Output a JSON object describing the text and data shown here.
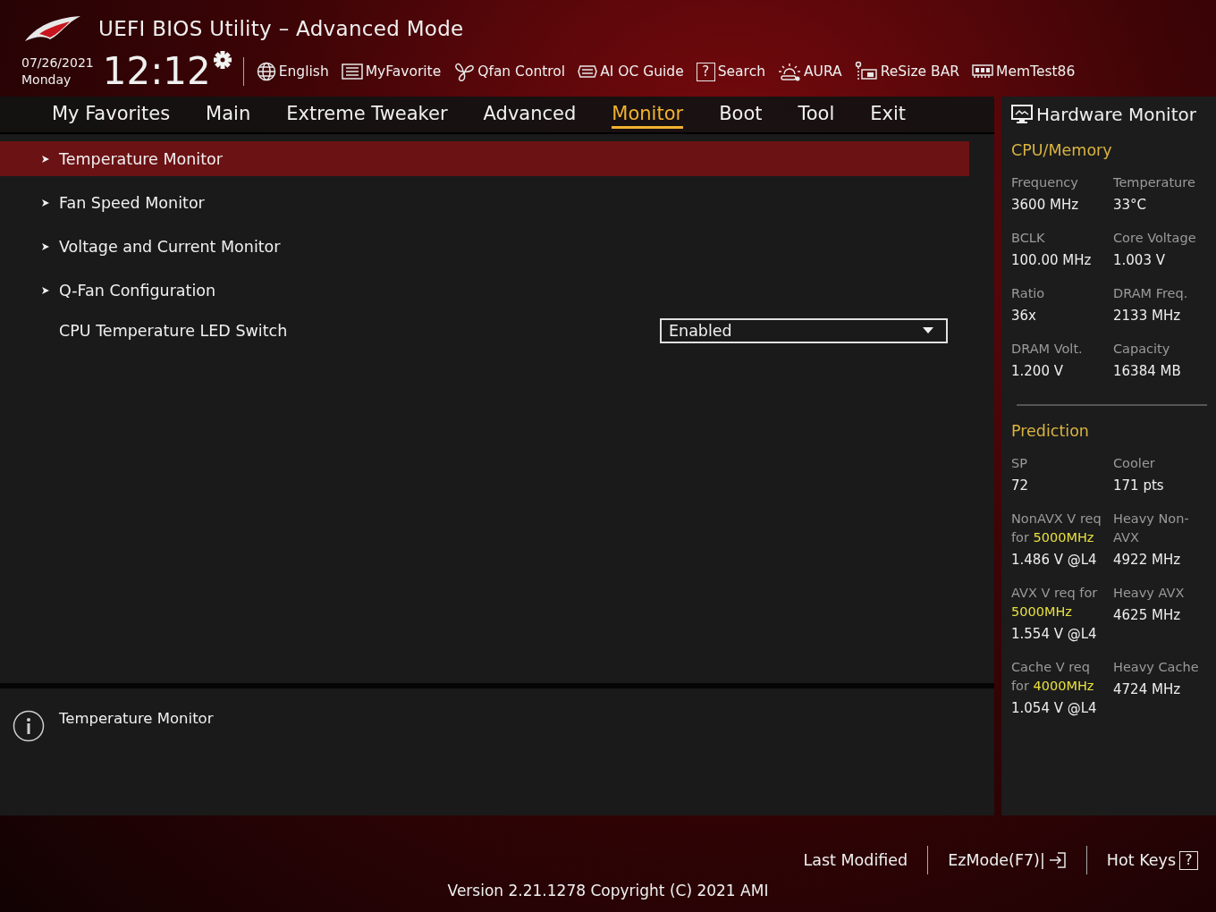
{
  "window": {
    "title": "UEFI BIOS Utility – Advanced Mode"
  },
  "clock": {
    "date": "07/26/2021",
    "weekday": "Monday",
    "time": "12:12"
  },
  "toolbar": [
    {
      "label": "English",
      "kind": "globe"
    },
    {
      "label": "MyFavorite",
      "kind": "list"
    },
    {
      "label": "Qfan Control",
      "kind": "fan"
    },
    {
      "label": "AI OC Guide",
      "kind": "chip"
    },
    {
      "label": "Search",
      "kind": "help",
      "icon_text": "?"
    },
    {
      "label": "AURA",
      "kind": "aura"
    },
    {
      "label": "ReSize BAR",
      "kind": "card"
    },
    {
      "label": "MemTest86",
      "kind": "memory"
    }
  ],
  "tabs": [
    {
      "label": "My Favorites",
      "selected": false
    },
    {
      "label": "Main",
      "selected": false
    },
    {
      "label": "Extreme Tweaker",
      "selected": false
    },
    {
      "label": "Advanced",
      "selected": false
    },
    {
      "label": "Monitor",
      "selected": true
    },
    {
      "label": "Boot",
      "selected": false
    },
    {
      "label": "Tool",
      "selected": false
    },
    {
      "label": "Exit",
      "selected": false
    }
  ],
  "menu": [
    {
      "kind": "submenu",
      "label": "Temperature Monitor",
      "selected": true
    },
    {
      "kind": "submenu",
      "label": "Fan Speed Monitor",
      "selected": false
    },
    {
      "kind": "submenu",
      "label": "Voltage and Current Monitor",
      "selected": false
    },
    {
      "kind": "submenu",
      "label": "Q-Fan Configuration",
      "selected": false
    },
    {
      "kind": "setting",
      "label": "CPU Temperature LED Switch",
      "value": "Enabled",
      "selected": false
    }
  ],
  "help": {
    "text": "Temperature Monitor"
  },
  "hardware_monitor": {
    "title": "Hardware Monitor",
    "sections": [
      {
        "title": "CPU/Memory",
        "items": [
          {
            "label": "Frequency",
            "value": "3600 MHz"
          },
          {
            "label": "Temperature",
            "value": "33°C"
          },
          {
            "label": "BCLK",
            "value": "100.00 MHz"
          },
          {
            "label": "Core Voltage",
            "value": "1.003 V"
          },
          {
            "label": "Ratio",
            "value": "36x"
          },
          {
            "label": "DRAM Freq.",
            "value": "2133 MHz"
          },
          {
            "label": "DRAM Volt.",
            "value": "1.200 V"
          },
          {
            "label": "Capacity",
            "value": "16384 MB"
          }
        ]
      },
      {
        "title": "Prediction",
        "items": [
          {
            "label": "SP",
            "value": "72"
          },
          {
            "label": "Cooler",
            "value": "171 pts"
          },
          {
            "label": "NonAVX V req for **5000MHz**",
            "value": "1.486 V @L4"
          },
          {
            "label": "Heavy Non-AVX",
            "value": "4922 MHz"
          },
          {
            "label": "AVX V req for **5000MHz**",
            "value": "1.554 V @L4"
          },
          {
            "label": "Heavy AVX",
            "value": "4625 MHz"
          },
          {
            "label": "Cache V req for **4000MHz**",
            "value": "1.054 V @L4"
          },
          {
            "label": "Heavy Cache",
            "value": "4724 MHz"
          }
        ]
      }
    ]
  },
  "footer": {
    "links": [
      {
        "kind": "text",
        "label": "Last Modified"
      },
      {
        "kind": "exit",
        "label": "EzMode(F7)|"
      },
      {
        "kind": "help",
        "label": "Hot Keys",
        "icon_text": "?"
      }
    ],
    "version": "Version 2.21.1278 Copyright (C) 2021 AMI"
  }
}
